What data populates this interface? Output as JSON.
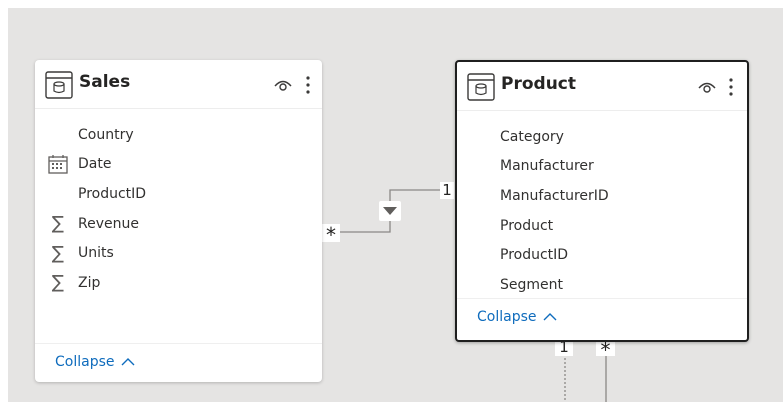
{
  "tables": {
    "sales": {
      "title": "Sales",
      "fields": [
        {
          "label": "Country",
          "icon": ""
        },
        {
          "label": "Date",
          "icon": "calendar-icon"
        },
        {
          "label": "ProductID",
          "icon": ""
        },
        {
          "label": "Revenue",
          "icon": "sigma-icon"
        },
        {
          "label": "Units",
          "icon": "sigma-icon"
        },
        {
          "label": "Zip",
          "icon": "sigma-icon"
        }
      ],
      "collapse_label": "Collapse"
    },
    "product": {
      "title": "Product",
      "fields": [
        {
          "label": "Category"
        },
        {
          "label": "Manufacturer"
        },
        {
          "label": "ManufacturerID"
        },
        {
          "label": "Product"
        },
        {
          "label": "ProductID"
        },
        {
          "label": "Segment"
        }
      ],
      "collapse_label": "Collapse"
    }
  },
  "relationships": {
    "sales_product": {
      "from_cardinality": "*",
      "to_cardinality": "1",
      "filter_direction": "single"
    },
    "product_below": {
      "left_cardinality": "1",
      "right_cardinality": "*"
    }
  },
  "colors": {
    "canvas": "#e5e4e3",
    "link": "#0f6cbd",
    "selected_border": "#1f1f1f"
  }
}
